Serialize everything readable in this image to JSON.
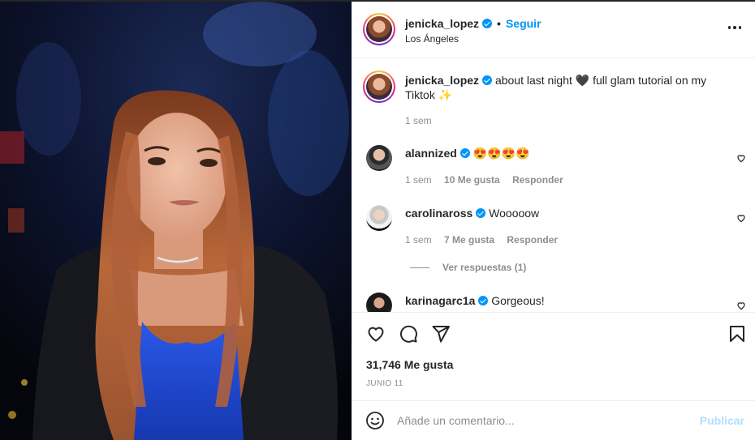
{
  "post": {
    "username": "jenicka_lopez",
    "follow_dot": "•",
    "follow_label": "Seguir",
    "location": "Los Ángeles",
    "more_icon": "more-horizontal-icon"
  },
  "caption": {
    "username": "jenicka_lopez",
    "text_part1": "about last night",
    "heart_emoji": "🖤",
    "text_part2": "full glam tutorial on my",
    "text_line2": "Tiktok",
    "sparkles_emoji": "✨",
    "time": "1 sem"
  },
  "comments": [
    {
      "username": "alannized",
      "text": "😍😍😍😍",
      "time": "1 sem",
      "likes": "10 Me gusta",
      "reply": "Responder"
    },
    {
      "username": "carolinaross",
      "text": "Wooooow",
      "time": "1 sem",
      "likes": "7 Me gusta",
      "reply": "Responder"
    },
    {
      "username": "karinagarc1a",
      "text": "Gorgeous!"
    }
  ],
  "view_replies": "Ver respuestas (1)",
  "actions": {
    "like_icon": "heart-outline-icon",
    "comment_icon": "comment-bubble-icon",
    "share_icon": "paper-plane-icon",
    "save_icon": "bookmark-icon",
    "likes_count": "31,746 Me gusta",
    "date": "JUNIO 11"
  },
  "comment_box": {
    "placeholder": "Añade un comentario...",
    "publish_label": "Publicar",
    "emoji_icon": "smiley-icon"
  },
  "colors": {
    "accent": "#0095f6",
    "publish_disabled": "#b2dffc",
    "muted_text": "#8e8e8e",
    "primary_text": "#262626",
    "divider": "#efefef"
  }
}
